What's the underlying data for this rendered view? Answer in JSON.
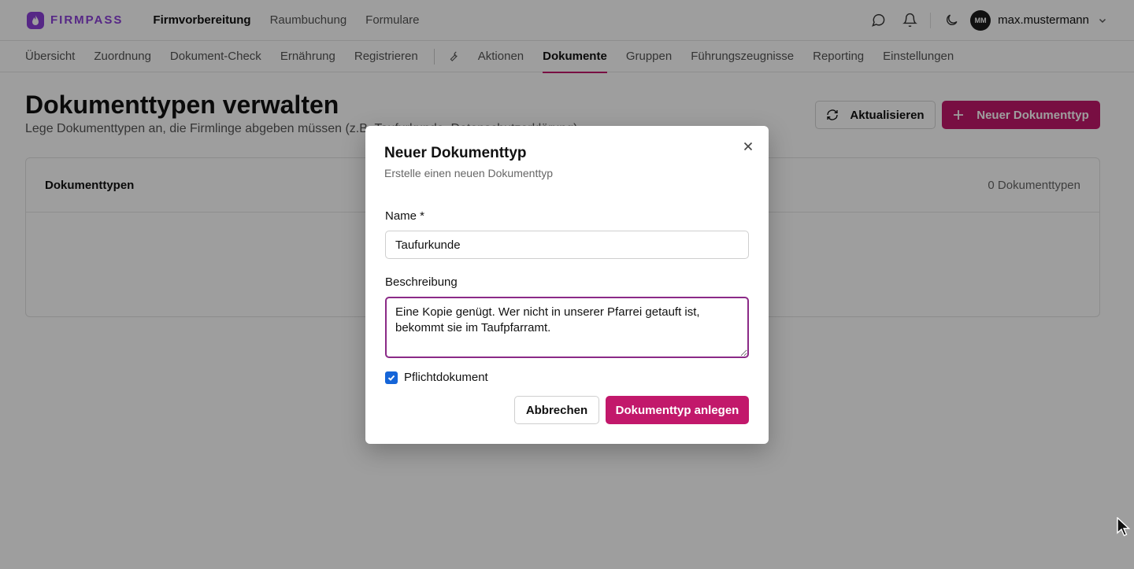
{
  "header": {
    "logo_text": "FIRMPASS",
    "nav": [
      "Firmvorbereitung",
      "Raumbuchung",
      "Formulare"
    ],
    "active_nav": "Firmvorbereitung",
    "user": {
      "initials": "MM",
      "name": "max.mustermann"
    }
  },
  "subnav": {
    "items": [
      "Übersicht",
      "Zuordnung",
      "Dokument-Check",
      "Ernährung",
      "Registrieren",
      "Aktionen",
      "Dokumente",
      "Gruppen",
      "Führungszeugnisse",
      "Reporting",
      "Einstellungen"
    ],
    "active": "Dokumente"
  },
  "page": {
    "title": "Dokumenttypen verwalten",
    "subtitle": "Lege Dokumenttypen an, die Firmlinge abgeben müssen (z.B. Taufurkunde, Datenschutzerklärung).",
    "refresh_label": "Aktualisieren",
    "new_label": "Neuer Dokumenttyp"
  },
  "card": {
    "title": "Dokumenttypen",
    "count": "0 Dokumenttypen"
  },
  "dialog": {
    "title": "Neuer Dokumenttyp",
    "subtitle": "Erstelle einen neuen Dokumenttyp",
    "name_label": "Name *",
    "name_value": "Taufurkunde",
    "desc_label": "Beschreibung",
    "desc_value": "Eine Kopie genügt. Wer nicht in unserer Pfarrei getauft ist, bekommt sie im Taufpfarramt.",
    "required_label": "Pflichtdokument",
    "required_checked": true,
    "cancel_label": "Abbrechen",
    "submit_label": "Dokumenttyp anlegen"
  },
  "colors": {
    "brand": "#8b3fd8",
    "primary": "#c2186b",
    "focus": "#8b2a87",
    "checkbox": "#1565d8"
  }
}
